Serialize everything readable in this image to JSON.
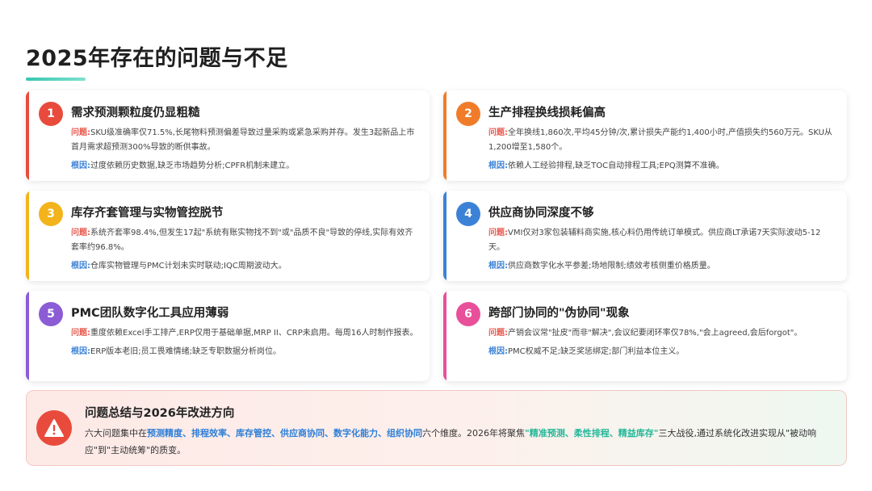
{
  "page": {
    "title": "2025年存在的问题与不足"
  },
  "labels": {
    "problem": "问题:",
    "cause": "根因:"
  },
  "colors": {
    "red": "#e84b3c",
    "orange": "#f07c2a",
    "yellow": "#f2b31b",
    "blue": "#3b82d6",
    "purple": "#8b5cd6",
    "pink": "#e8509a",
    "teal": "#36c7b0"
  },
  "cards": [
    {
      "number": "1",
      "title": "需求预测颗粒度仍显粗糙",
      "problem": "SKU级准确率仅71.5%,长尾物料预测偏差导致过量采购或紧急采购并存。发生3起新品上市首月需求超预测300%导致的断供事故。",
      "cause": "过度依赖历史数据,缺乏市场趋势分析;CPFR机制未建立。"
    },
    {
      "number": "2",
      "title": "生产排程换线损耗偏高",
      "problem": "全年换线1,860次,平均45分钟/次,累计损失产能约1,400小时,产值损失约560万元。SKU从1,200增至1,580个。",
      "cause": "依赖人工经验排程,缺乏TOC自动排程工具;EPQ测算不准确。"
    },
    {
      "number": "3",
      "title": "库存齐套管理与实物管控脱节",
      "problem": "系统齐套率98.4%,但发生17起\"系统有账实物找不到\"或\"品质不良\"导致的停线,实际有效齐套率约96.8%。",
      "cause": "仓库实物管理与PMC计划未实时联动;IQC周期波动大。"
    },
    {
      "number": "4",
      "title": "供应商协同深度不够",
      "problem": "VMI仅对3家包装辅料商实施,核心料仍用传统订单模式。供应商LT承诺7天实际波动5-12天。",
      "cause": "供应商数字化水平参差;场地限制;绩效考核侧重价格质量。"
    },
    {
      "number": "5",
      "title": "PMC团队数字化工具应用薄弱",
      "problem": "重度依赖Excel手工排产,ERP仅用于基础单据,MRP II、CRP未启用。每周16人时制作报表。",
      "cause": "ERP版本老旧;员工畏难情绪;缺乏专职数据分析岗位。"
    },
    {
      "number": "6",
      "title": "跨部门协同的\"伪协同\"现象",
      "problem": "产销会议常\"扯皮\"而非\"解决\",会议纪要闭环率仅78%,\"会上agreed,会后forgot\"。",
      "cause": "PMC权威不足;缺乏奖惩绑定;部门利益本位主义。"
    }
  ],
  "summary": {
    "title": "问题总结与2026年改进方向",
    "t1": "六大问题集中在",
    "k1": "预测精度、排程效率、库存管控、供应商协同、数字化能力、组织协同",
    "t2": "六个维度。2026年将聚焦",
    "k2": "\"精准预测、柔性排程、精益库存\"",
    "t3": "三大战役,通过系统化改进实现从\"被动响应\"到\"主动统筹\"的质变。"
  }
}
